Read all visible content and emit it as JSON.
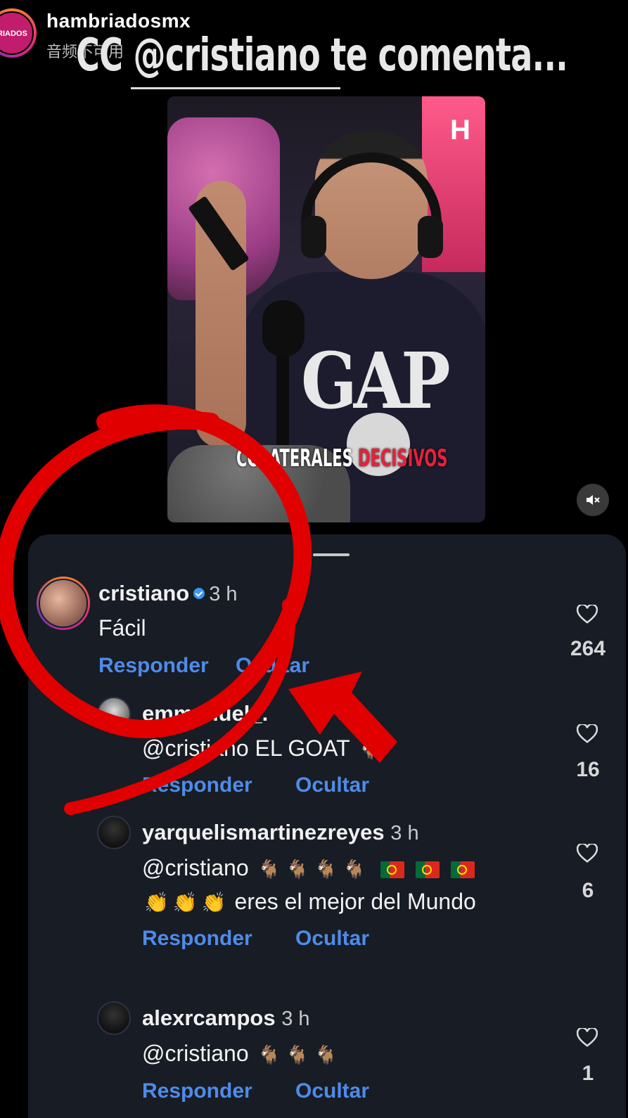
{
  "story": {
    "username": "hambriadosmx",
    "audio_note": "音频不可用",
    "avatar_label": "RIADOS",
    "headline": "CC @cristiano te comenta..."
  },
  "video": {
    "caption_word_1": "COLATERALES",
    "caption_word_2": "DECISIVOS",
    "shirt_text": "GAP",
    "sign_text": "H",
    "mute_icon": "speaker-muted-icon"
  },
  "comments": [
    {
      "user": "cristiano",
      "verified": true,
      "time": "3 h",
      "text": "Fácil",
      "reply": "Responder",
      "hide": "Ocultar",
      "likes": "264"
    },
    {
      "user": "emmanuel_.",
      "time": "3 h",
      "text": "@cristiano EL GOAT",
      "reply": "Responder",
      "hide": "Ocultar",
      "likes": "16"
    },
    {
      "user": "yarquelismartinezreyes",
      "time": "3 h",
      "mention": "@cristiano",
      "text_line2": "eres el mejor del Mundo",
      "reply": "Responder",
      "hide": "Ocultar",
      "likes": "6"
    },
    {
      "user": "alexrcampos",
      "time": "3 h",
      "mention": "@cristiano",
      "reply": "Responder",
      "hide": "Ocultar",
      "likes": "1"
    }
  ],
  "icons": {
    "like": "heart-outline-icon",
    "goat": "goat-emoji",
    "flag": "portugal-flag-emoji",
    "clap": "clapping-hands-emoji",
    "verified": "verified-badge-icon"
  },
  "colors": {
    "action_blue": "#4f8be8",
    "panel_bg": "#171c25",
    "annotation_red": "#e00000"
  },
  "emoji_glyphs": {
    "goat": "🐐",
    "clap": "👏"
  }
}
